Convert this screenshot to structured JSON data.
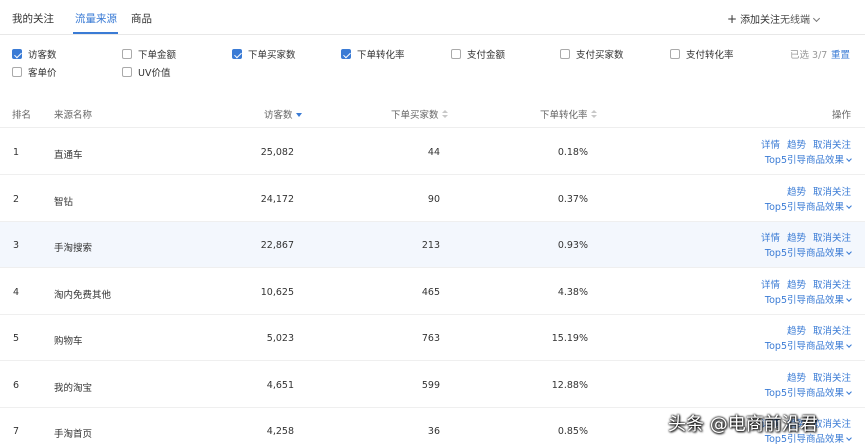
{
  "tabs": [
    {
      "label": "我的关注",
      "active": false
    },
    {
      "label": "流量来源",
      "active": true
    },
    {
      "label": "商品",
      "active": false
    }
  ],
  "top_actions": {
    "add_follow": "添加关注",
    "device": "无线端"
  },
  "filters": {
    "items": [
      {
        "label": "访客数",
        "checked": true
      },
      {
        "label": "下单金额",
        "checked": false
      },
      {
        "label": "下单买家数",
        "checked": true
      },
      {
        "label": "下单转化率",
        "checked": true
      },
      {
        "label": "支付金额",
        "checked": false
      },
      {
        "label": "支付买家数",
        "checked": false
      },
      {
        "label": "支付转化率",
        "checked": false
      },
      {
        "label": "客单价",
        "checked": false
      },
      {
        "label": "UV价值",
        "checked": false
      }
    ],
    "selected_count": "已选 3/7",
    "reset": "重置"
  },
  "table": {
    "headers": {
      "rank": "排名",
      "source": "来源名称",
      "visitors": "访客数",
      "buyers": "下单买家数",
      "conversion": "下单转化率",
      "action": "操作"
    },
    "rows": [
      {
        "rank": "1",
        "source": "直通车",
        "visitors": "25,082",
        "buyers": "44",
        "conversion": "0.18%",
        "has_detail": true,
        "highlight": false
      },
      {
        "rank": "2",
        "source": "智钻",
        "visitors": "24,172",
        "buyers": "90",
        "conversion": "0.37%",
        "has_detail": false,
        "highlight": false
      },
      {
        "rank": "3",
        "source": "手淘搜索",
        "visitors": "22,867",
        "buyers": "213",
        "conversion": "0.93%",
        "has_detail": true,
        "highlight": true
      },
      {
        "rank": "4",
        "source": "淘内免费其他",
        "visitors": "10,625",
        "buyers": "465",
        "conversion": "4.38%",
        "has_detail": true,
        "highlight": false
      },
      {
        "rank": "5",
        "source": "购物车",
        "visitors": "5,023",
        "buyers": "763",
        "conversion": "15.19%",
        "has_detail": false,
        "highlight": false
      },
      {
        "rank": "6",
        "source": "我的淘宝",
        "visitors": "4,651",
        "buyers": "599",
        "conversion": "12.88%",
        "has_detail": false,
        "highlight": false
      },
      {
        "rank": "7",
        "source": "手淘首页",
        "visitors": "4,258",
        "buyers": "36",
        "conversion": "0.85%",
        "has_detail": true,
        "highlight": false
      }
    ],
    "actions": {
      "detail": "详情",
      "trend": "趋势",
      "unfollow": "取消关注",
      "top5": "Top5引导商品效果"
    }
  },
  "watermark": "头条 @电商前沿君",
  "colors": {
    "accent": "#3a7bd5",
    "row_highlight": "#f3f7fd"
  }
}
